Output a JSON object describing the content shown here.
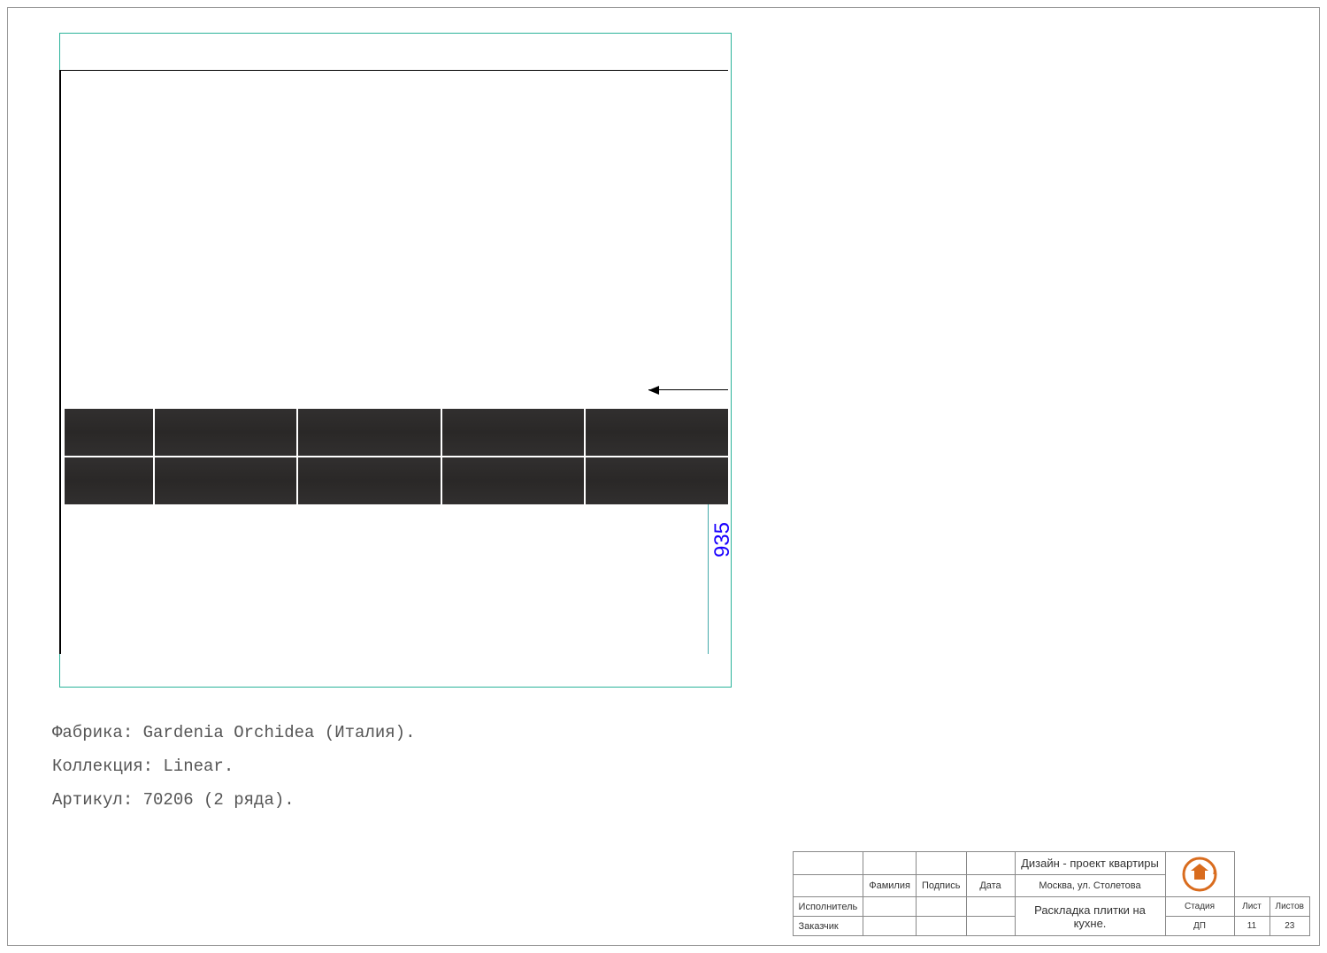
{
  "drawing": {
    "dimension_935": "935"
  },
  "notes": {
    "line1": "Фабрика: Gardenia Orchidea (Италия).",
    "line2": "Коллекция: Linear.",
    "line3": "Артикул: 70206 (2 ряда)."
  },
  "titleblock": {
    "headers": {
      "famil": "Фамилия",
      "podpis": "Подпись",
      "data": "Дата"
    },
    "roles": {
      "ispolnitel": "Исполнитель",
      "zakazchik": "Заказчик"
    },
    "project_title": "Дизайн - проект квартиры",
    "address": "Москва, ул. Столетова",
    "drawing_title": "Раскладка плитки на кухне.",
    "cols": {
      "stadiya_h": "Стадия",
      "list_h": "Лист",
      "listov_h": "Листов",
      "stadiya": "ДП",
      "list": "11",
      "listov": "23"
    }
  }
}
